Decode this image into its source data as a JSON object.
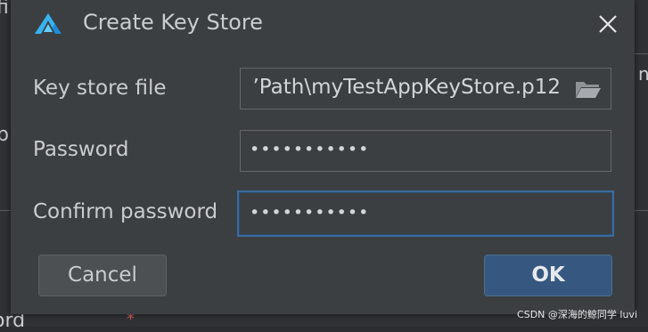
{
  "dialog": {
    "title": "Create Key Store",
    "fields": {
      "keystore_file": {
        "label": "Key store file",
        "value": "’Path\\myTestAppKeyStore.p12"
      },
      "password": {
        "label": "Password",
        "value": "•••••••••••"
      },
      "confirm_password": {
        "label": "Confirm password",
        "value": "•••••••••••"
      }
    },
    "buttons": {
      "cancel": "Cancel",
      "ok": "OK"
    }
  },
  "background": {
    "frag_top": "fi",
    "frag_mid": "p",
    "frag_bottom": "ord",
    "frag_right": "n",
    "required_marker": "*"
  },
  "watermark": "CSDN @深海的鲸同学 luvi",
  "colors": {
    "dialog_bg": "#3c3f41",
    "text": "#c9ccd1",
    "ok_button": "#365880",
    "focus_border": "#3d6a9e"
  },
  "icons": {
    "logo": "harmonyos-devtool-logo",
    "close": "close-icon",
    "folder": "folder-open-icon"
  }
}
